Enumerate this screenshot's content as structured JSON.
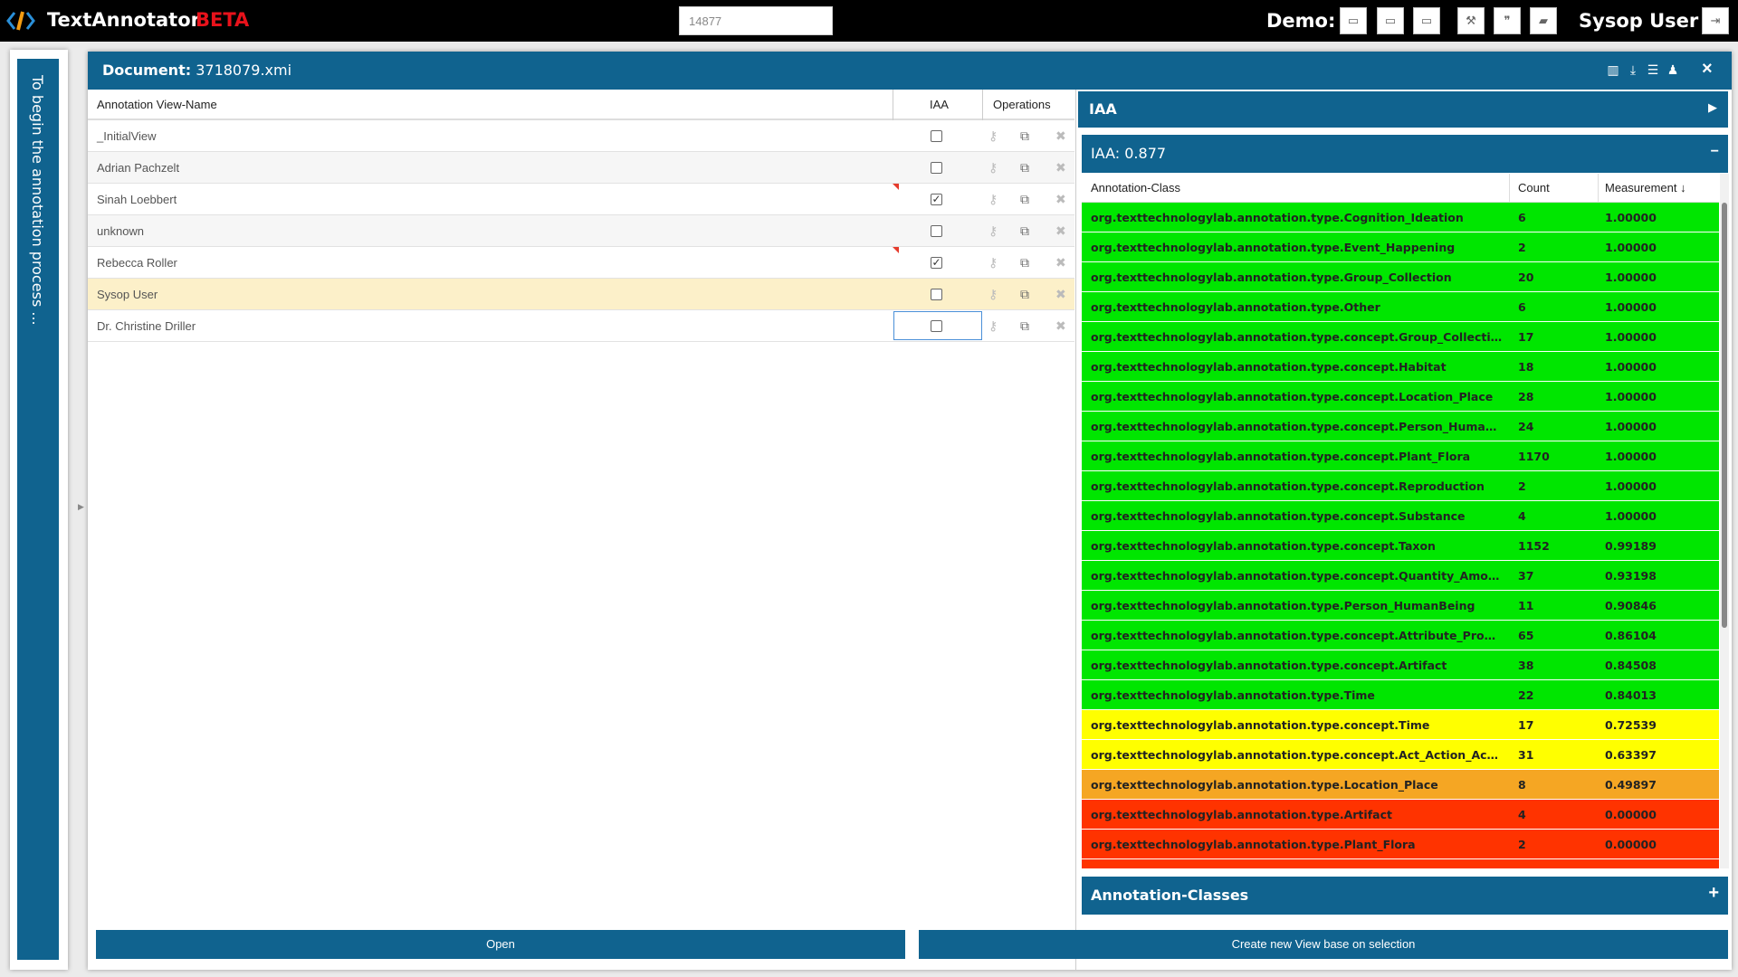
{
  "app": {
    "title": "TextAnnotator",
    "beta": "BETA",
    "search_value": "14877",
    "demo_label": "Demo:",
    "user": "Sysop User"
  },
  "sidebar": {
    "text": "To begin the annotation process ..."
  },
  "document": {
    "label": "Document:",
    "name": "3718079.xmi"
  },
  "views_table": {
    "headers": {
      "name": "Annotation View-Name",
      "iaa": "IAA",
      "ops": "Operations"
    },
    "rows": [
      {
        "name": "_InitialView",
        "checked": false
      },
      {
        "name": "Adrian Pachzelt",
        "checked": false
      },
      {
        "name": "Sinah Loebbert",
        "checked": true
      },
      {
        "name": "unknown",
        "checked": false
      },
      {
        "name": "Rebecca Roller",
        "checked": true
      },
      {
        "name": "Sysop User",
        "checked": false
      },
      {
        "name": "Dr. Christine Driller",
        "checked": false
      }
    ]
  },
  "iaa_panel": {
    "title": "IAA",
    "score": "IAA: 0.877"
  },
  "class_table": {
    "headers": {
      "cls": "Annotation-Class",
      "count": "Count",
      "measure": "Measurement"
    },
    "colors": {
      "green": "#00e600",
      "yellow": "#ffff00",
      "orange": "#f5a623",
      "red": "#ff3300"
    },
    "rows": [
      {
        "cls": "org.texttechnologylab.annotation.type.Cognition_Ideation",
        "count": "6",
        "measure": "1.00000",
        "color": "green"
      },
      {
        "cls": "org.texttechnologylab.annotation.type.Event_Happening",
        "count": "2",
        "measure": "1.00000",
        "color": "green"
      },
      {
        "cls": "org.texttechnologylab.annotation.type.Group_Collection",
        "count": "20",
        "measure": "1.00000",
        "color": "green"
      },
      {
        "cls": "org.texttechnologylab.annotation.type.Other",
        "count": "6",
        "measure": "1.00000",
        "color": "green"
      },
      {
        "cls": "org.texttechnologylab.annotation.type.concept.Group_Collection",
        "count": "17",
        "measure": "1.00000",
        "color": "green"
      },
      {
        "cls": "org.texttechnologylab.annotation.type.concept.Habitat",
        "count": "18",
        "measure": "1.00000",
        "color": "green"
      },
      {
        "cls": "org.texttechnologylab.annotation.type.concept.Location_Place",
        "count": "28",
        "measure": "1.00000",
        "color": "green"
      },
      {
        "cls": "org.texttechnologylab.annotation.type.concept.Person_HumanBei...",
        "count": "24",
        "measure": "1.00000",
        "color": "green"
      },
      {
        "cls": "org.texttechnologylab.annotation.type.concept.Plant_Flora",
        "count": "1170",
        "measure": "1.00000",
        "color": "green"
      },
      {
        "cls": "org.texttechnologylab.annotation.type.concept.Reproduction",
        "count": "2",
        "measure": "1.00000",
        "color": "green"
      },
      {
        "cls": "org.texttechnologylab.annotation.type.concept.Substance",
        "count": "4",
        "measure": "1.00000",
        "color": "green"
      },
      {
        "cls": "org.texttechnologylab.annotation.type.concept.Taxon",
        "count": "1152",
        "measure": "0.99189",
        "color": "green"
      },
      {
        "cls": "org.texttechnologylab.annotation.type.concept.Quantity_Amount",
        "count": "37",
        "measure": "0.93198",
        "color": "green"
      },
      {
        "cls": "org.texttechnologylab.annotation.type.Person_HumanBeing",
        "count": "11",
        "measure": "0.90846",
        "color": "green"
      },
      {
        "cls": "org.texttechnologylab.annotation.type.concept.Attribute_Property",
        "count": "65",
        "measure": "0.86104",
        "color": "green"
      },
      {
        "cls": "org.texttechnologylab.annotation.type.concept.Artifact",
        "count": "38",
        "measure": "0.84508",
        "color": "green"
      },
      {
        "cls": "org.texttechnologylab.annotation.type.Time",
        "count": "22",
        "measure": "0.84013",
        "color": "green"
      },
      {
        "cls": "org.texttechnologylab.annotation.type.concept.Time",
        "count": "17",
        "measure": "0.72539",
        "color": "yellow"
      },
      {
        "cls": "org.texttechnologylab.annotation.type.concept.Act_Action_Activity",
        "count": "31",
        "measure": "0.63397",
        "color": "yellow"
      },
      {
        "cls": "org.texttechnologylab.annotation.type.Location_Place",
        "count": "8",
        "measure": "0.49897",
        "color": "orange"
      },
      {
        "cls": "org.texttechnologylab.annotation.type.Artifact",
        "count": "4",
        "measure": "0.00000",
        "color": "red"
      },
      {
        "cls": "org.texttechnologylab.annotation.type.Plant_Flora",
        "count": "2",
        "measure": "0.00000",
        "color": "red"
      },
      {
        "cls": "",
        "count": "",
        "measure": "",
        "color": "red"
      }
    ]
  },
  "annotation_classes_panel": {
    "title": "Annotation-Classes"
  },
  "buttons": {
    "open": "Open",
    "create": "Create new View base on selection"
  }
}
